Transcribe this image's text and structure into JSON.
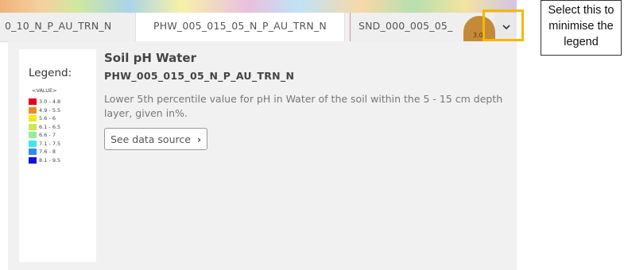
{
  "tabs": [
    {
      "label": "0_10_N_P_AU_TRN_N"
    },
    {
      "label": "PHW_005_015_05_N_P_AU_TRN_N"
    },
    {
      "label": "SND_000_005_05_"
    }
  ],
  "map_marker_text": "3.0",
  "panel": {
    "legend": {
      "title": "Legend:",
      "subtitle": "<VALUE>",
      "items": [
        {
          "label": "3.0 - 4.8",
          "color": "#e8001a"
        },
        {
          "label": "4.9 - 5.5",
          "color": "#f28a1c"
        },
        {
          "label": "5.6 - 6",
          "color": "#f5e61e"
        },
        {
          "label": "6.1 - 6.5",
          "color": "#c8ec4a"
        },
        {
          "label": "6.6 - 7",
          "color": "#8ef09a"
        },
        {
          "label": "7.1 - 7.5",
          "color": "#3fe6e6"
        },
        {
          "label": "7.6 - 8",
          "color": "#2f8cf0"
        },
        {
          "label": "8.1 - 9.5",
          "color": "#1212e0"
        }
      ]
    },
    "title": "Soil pH Water",
    "code": "PHW_005_015_05_N_P_AU_TRN_N",
    "description": "Lower 5th percentile value for pH in Water of the soil within the 5 - 15 cm depth layer, given in%.",
    "see_source_label": "See data source"
  },
  "annotation": {
    "text": "Select this to minimise the legend"
  },
  "colors": {
    "highlight": "#f5b800",
    "panel_bg": "#f1f1f1"
  }
}
